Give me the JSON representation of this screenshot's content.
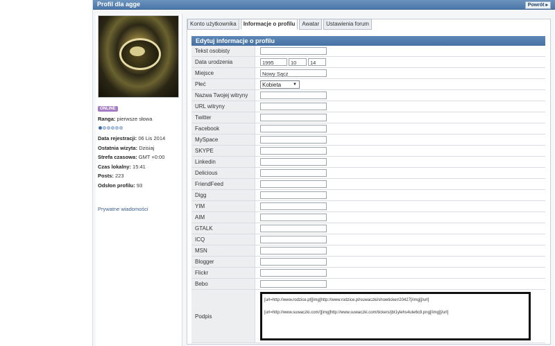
{
  "header": {
    "title": "Profil dla agge",
    "back_label": "Powrót"
  },
  "tabs": [
    "Konto użytkownika",
    "Informacje o profilu",
    "Awatar",
    "Ustawienia forum"
  ],
  "sidebar": {
    "online_badge": "ONLINE",
    "rank_label": "Ranga:",
    "rank_value": "pierwsze słowa",
    "rank_dots_filled": 1,
    "rank_dots_total": 6,
    "stats": [
      {
        "label": "Data rejestracji:",
        "value": "06 Lis 2014"
      },
      {
        "label": "Ostatnia wizyta:",
        "value": "Dzisiaj"
      },
      {
        "label": "Strefa czasowa:",
        "value": "GMT +0:00"
      },
      {
        "label": "Czas lokalny:",
        "value": "15:41"
      },
      {
        "label": "Posts:",
        "value": "223"
      },
      {
        "label": "Odsłon profilu:",
        "value": "93"
      }
    ],
    "pm_link": "Prywatne wiadomości"
  },
  "form": {
    "section_title": "Edytuj informacje o profilu",
    "personal_text_label": "Tekst osobisty",
    "birthdate": {
      "label": "Data urodzenia",
      "year": "1995",
      "month": "10",
      "day": "14"
    },
    "location": {
      "label": "Miejsce",
      "value": "Nowy Sącz"
    },
    "gender": {
      "label": "Płeć",
      "selected": "Kobieta"
    },
    "fields": [
      "Nazwa Twojej witryny",
      "URL witryny",
      "Twitter",
      "Facebook",
      "MySpace",
      "SKYPE",
      "Linkedin",
      "Delicious",
      "FriendFeed",
      "Digg",
      "YIM",
      "AIM",
      "GTALK",
      "ICQ",
      "MSN",
      "Blogger",
      "Flickr",
      "Bebo"
    ],
    "signature": {
      "label": "Podpis",
      "line1": "[url=http://www.rodzice.pl][img]http://www.rodzice.pl/suwaczki/showticker/20427[/img][/url]",
      "line2": "[url=http://www.suwaczki.com/][img]http://www.suwaczki.com/tickers/jbt1ylehs4ute6c8.png[/img][/url]"
    }
  }
}
